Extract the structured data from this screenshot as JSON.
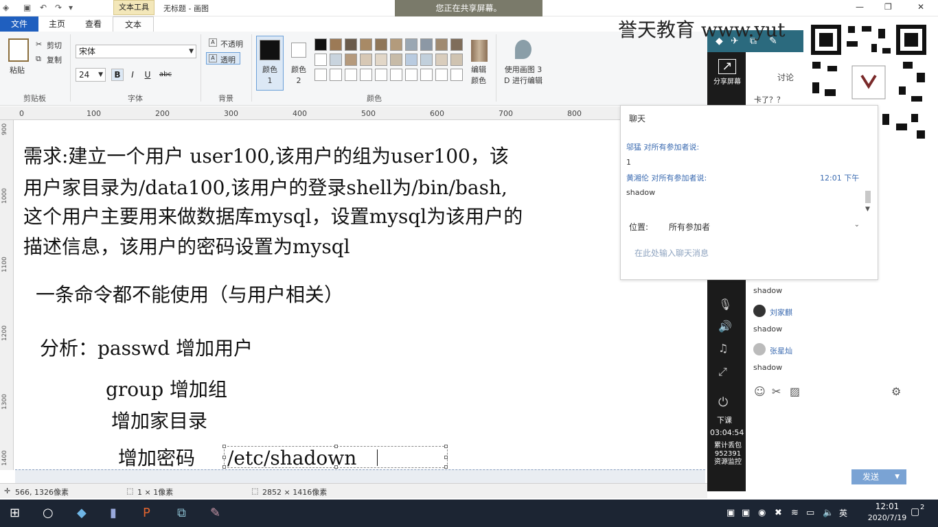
{
  "app": {
    "context_tab": "文本工具",
    "doc_title": "无标题 - 画图",
    "share_banner": "您正在共享屏幕。"
  },
  "tabs": {
    "file": "文件",
    "home": "主页",
    "view": "查看",
    "text": "文本"
  },
  "ribbon": {
    "paste": "粘贴",
    "cut": "剪切",
    "copy": "复制",
    "clipboard_label": "剪贴板",
    "font_name": "宋体",
    "font_size": "24",
    "bold": "B",
    "italic": "I",
    "underline": "U",
    "strike": "abc",
    "font_label": "字体",
    "opaque": "不透明",
    "transparent": "透明",
    "background_label": "背景",
    "color1": "颜色 1",
    "color2": "颜色 2",
    "edit_colors": "编辑颜色",
    "paint3d": "使用画图 3 D 进行编辑",
    "colors_label": "颜色"
  },
  "ruler": {
    "ticks": [
      "0",
      "100",
      "200",
      "300",
      "400",
      "500",
      "600",
      "700",
      "800"
    ],
    "left_ticks": [
      "900",
      "1000",
      "1100",
      "1200",
      "1300",
      "1400"
    ]
  },
  "canvas": {
    "line1": "需求:建立一个用户 user100,该用户的组为user100，该",
    "line2": "用户家目录为/data100,该用户的登录shell为/bin/bash,",
    "line3": "这个用户主要用来做数据库mysql，设置mysql为该用户的",
    "line4": "描述信息，该用户的密码设置为mysql",
    "line5": "一条命令都不能使用（与用户相关）",
    "line6": "分析：passwd 增加用户",
    "line7": "group 增加组",
    "line8": "增加家目录",
    "line9": "增加密码",
    "textbox": "/etc/shadown"
  },
  "status": {
    "cursor": "566, 1326像素",
    "selection": "1 × 1像素",
    "image_size": "2852 × 1416像素"
  },
  "brand": {
    "text": "誉天教育 www.yut"
  },
  "side": {
    "share_screen": "分享屏幕",
    "discuss": "讨论",
    "stuck_msg": "卡了？？",
    "end_class": "下课",
    "timer": "03:04:54",
    "stats_line1": "累计丢包",
    "stats_line2": "952391",
    "stats_line3": "资源监控",
    "msg_shadow1": "shadow",
    "name1": "刘家麒",
    "msg_shadow2": "shadow",
    "name2": "张星灿",
    "msg_shadow3": "shadow",
    "send": "发送"
  },
  "chat": {
    "title": "聊天",
    "sender1": "邬猛 对所有参加者说:",
    "msg1": "1",
    "sender2": "黄湘伦 对所有参加者说:",
    "time2": "12:01 下午",
    "msg2": "shadow",
    "pos_label": "位置:",
    "pos_value": "所有参加者",
    "input_placeholder": "在此处输入聊天消息"
  },
  "taskbar": {
    "ime": "英",
    "time": "12:01",
    "date": "2020/7/19",
    "notif": "2"
  },
  "colors": {
    "accent": "#1f5fbf",
    "panel_dark": "#1b1b1b",
    "taskbar": "#1c2533"
  }
}
